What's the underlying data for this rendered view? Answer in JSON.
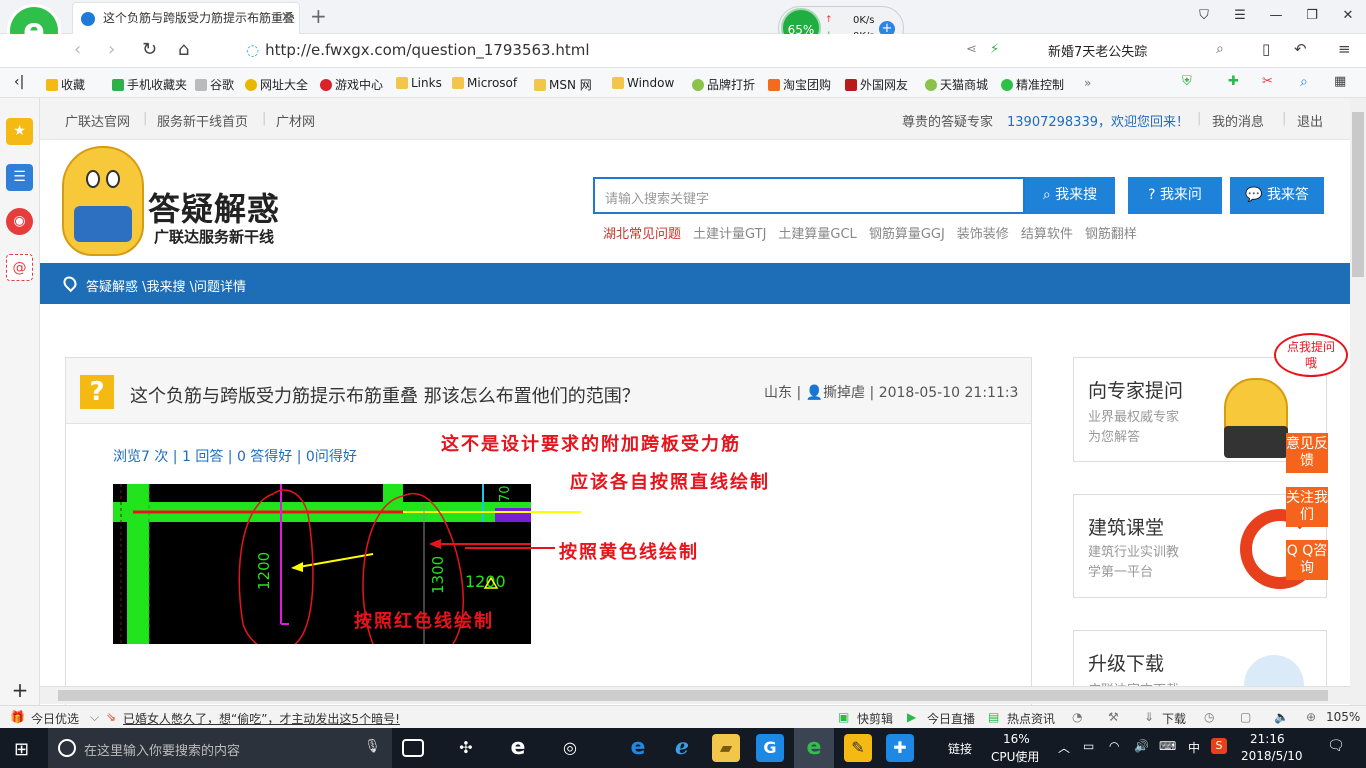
{
  "browser": {
    "tab_title": "这个负筋与跨版受力筋提示布筋重叠",
    "url": "http://e.fwxgx.com/question_1793563.html",
    "hot_search": "新婚7天老公失踪",
    "net_widget": {
      "percent": "65%",
      "up": "0K/s",
      "down": "0K/s"
    },
    "bookmarks": [
      "收藏",
      "手机收藏夹",
      "谷歌",
      "网址大全",
      "游戏中心",
      "Links",
      "Microsof",
      "MSN 网",
      "Window",
      "品牌打折",
      "淘宝团购",
      "外国网友",
      "天猫商城",
      "精准控制"
    ]
  },
  "top_nav": {
    "links": [
      "广联达官网",
      "服务新干线首页",
      "广材网"
    ],
    "expert_label": "尊贵的答疑专家",
    "welcome": "13907298339，欢迎您回来！",
    "messages": "我的消息",
    "logout": "退出"
  },
  "brand": {
    "title": "答疑解惑",
    "subtitle": "广联达服务新干线"
  },
  "search": {
    "placeholder": "请输入搜索关键字",
    "btn_search": "我来搜",
    "btn_ask": "我来问",
    "btn_answer": "我来答",
    "hot_links": [
      "湖北常见问题",
      "土建计量GTJ",
      "土建算量GCL",
      "钢筋算量GGJ",
      "装饰装修",
      "结算软件",
      "钢筋翻样"
    ]
  },
  "breadcrumb": "答疑解惑 \\我来搜 \\问题详情",
  "question": {
    "title": "这个负筋与跨版受力筋提示布筋重叠 那该怎么布置他们的范围？",
    "region": "山东",
    "user": "撕掉虐",
    "datetime": "2018-05-10 21:11:3",
    "stats": "浏览7 次 | 1 回答 | 0 答得好 | 0问得好",
    "cad_labels": [
      "1200",
      "1300",
      "1200",
      "70"
    ],
    "annotations": [
      "这不是设计要求的附加跨板受力筋",
      "应该各自按照直线绘制",
      "按照黄色线绘制",
      "按照红色线绘制"
    ]
  },
  "sidebar_cards": [
    {
      "title": "向专家提问",
      "sub1": "业界最权威专家",
      "sub2": "为您解答",
      "bubble": "点我提问哦"
    },
    {
      "title": "建筑课堂",
      "sub1": "建筑行业实训教",
      "sub2": "学第一平台"
    },
    {
      "title": "升级下载",
      "sub1": "广联达官方下载",
      "sub2": ""
    }
  ],
  "float_buttons": [
    "意见反馈",
    "关注我们",
    "Q Q咨询"
  ],
  "status_bar": {
    "left": "今日优选",
    "news": "已婚女人憋久了，想“偷吃”，才主动发出这5个暗号!",
    "items": [
      "快剪辑",
      "今日直播",
      "热点资讯",
      "下载"
    ],
    "zoom": "105%"
  },
  "taskbar": {
    "search_placeholder": "在这里输入你要搜索的内容",
    "link_label": "链接",
    "cpu": "16%",
    "cpu_label": "CPU使用",
    "ime": "中",
    "time": "21:16",
    "date": "2018/5/10"
  },
  "colors": {
    "accent_blue": "#1d6eb7",
    "annotation_red": "#e8141c",
    "float_orange": "#f4641c"
  }
}
